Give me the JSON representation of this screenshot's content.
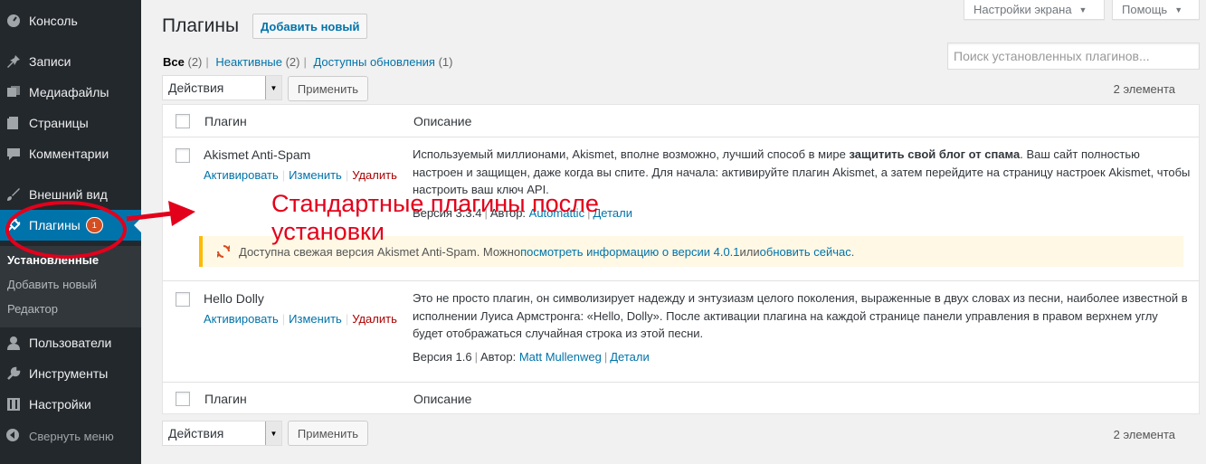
{
  "sidebar": {
    "items": [
      {
        "label": "Консоль",
        "icon": "dashboard-icon"
      },
      {
        "label": "Записи",
        "icon": "pin-icon"
      },
      {
        "label": "Медиафайлы",
        "icon": "media-icon"
      },
      {
        "label": "Страницы",
        "icon": "pages-icon"
      },
      {
        "label": "Комментарии",
        "icon": "comment-icon"
      },
      {
        "label": "Внешний вид",
        "icon": "brush-icon"
      },
      {
        "label": "Плагины",
        "icon": "plugin-icon",
        "badge": "1"
      },
      {
        "label": "Пользователи",
        "icon": "users-icon"
      },
      {
        "label": "Инструменты",
        "icon": "wrench-icon"
      },
      {
        "label": "Настройки",
        "icon": "settings-icon"
      }
    ],
    "submenu": [
      "Установленные",
      "Добавить новый",
      "Редактор"
    ],
    "collapse_label": "Свернуть меню"
  },
  "screen_options_label": "Настройки экрана",
  "help_label": "Помощь",
  "page_title": "Плагины",
  "add_new_label": "Добавить новый",
  "filters": {
    "all": "Все",
    "all_count": "(2)",
    "inactive": "Неактивные",
    "inactive_count": "(2)",
    "updates": "Доступны обновления",
    "updates_count": "(1)"
  },
  "search_placeholder": "Поиск установленных плагинов...",
  "bulk_action_label": "Действия",
  "apply_label": "Применить",
  "items_count": "2 элемента",
  "table": {
    "col_plugin": "Плагин",
    "col_description": "Описание"
  },
  "plugins": [
    {
      "name": "Akismet Anti-Spam",
      "activate": "Активировать",
      "edit": "Изменить",
      "delete": "Удалить",
      "desc_pre": "Используемый миллионами, Akismet, вполне возможно, лучший способ в мире ",
      "desc_bold": "защитить свой блог от спама",
      "desc_post": ". Ваш сайт полностью настроен и защищен, даже когда вы спите. Для начала: активируйте плагин Akismet, а затем перейдите на страницу настроек Akismet, чтобы настроить ваш ключ API.",
      "version": "Версия 3.3.4",
      "author_prefix": "Автор:",
      "author": "Automattic",
      "details": "Детали"
    },
    {
      "name": "Hello Dolly",
      "activate": "Активировать",
      "edit": "Изменить",
      "delete": "Удалить",
      "desc": "Это не просто плагин, он символизирует надежду и энтузиазм целого поколения, выраженные в двух словах из песни, наиболее известной в исполнении Луиса Армстронга: «Hello, Dolly». После активации плагина на каждой странице панели управления в правом верхнем углу будет отображаться случайная строка из этой песни.",
      "version": "Версия 1.6",
      "author_prefix": "Автор:",
      "author": "Matt Mullenweg",
      "details": "Детали"
    }
  ],
  "update_notice": {
    "text_pre": "Доступна свежая версия Akismet Anti-Spam. Можно ",
    "link_info": "посмотреть информацию о версии 4.0.1",
    "text_mid": " или ",
    "link_update": "обновить сейчас",
    "text_post": "."
  },
  "annotation": {
    "line1": "Стандартные плагины после",
    "line2": "установки",
    "color": "#e3001b"
  },
  "colors": {
    "sidebar_bg": "#23282d",
    "active_bg": "#0073aa",
    "link": "#0073aa",
    "delete": "#a00"
  }
}
